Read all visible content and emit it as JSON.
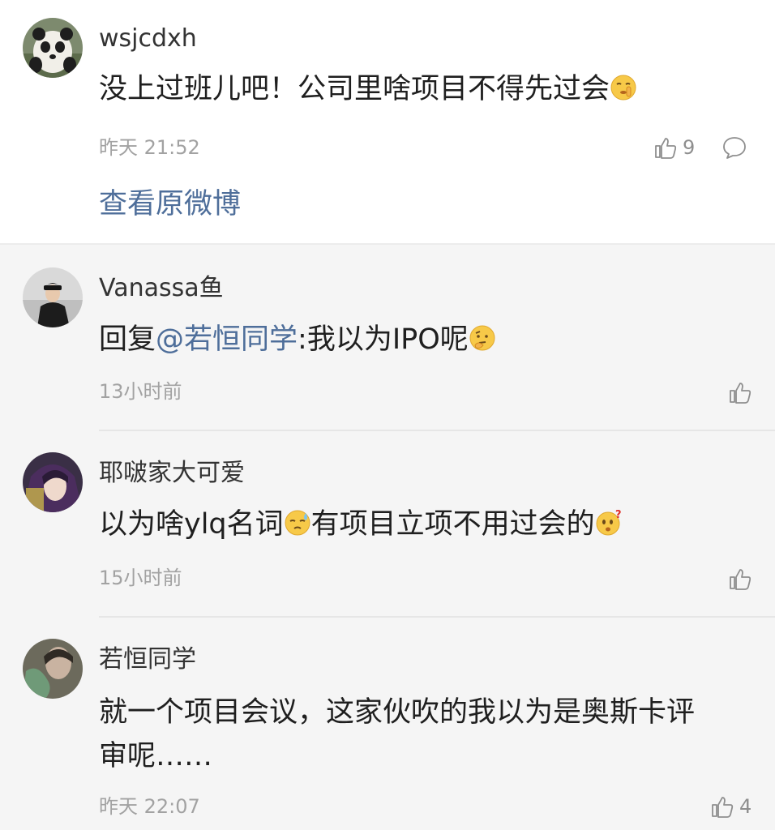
{
  "main_comment": {
    "username": "wsjcdxh",
    "content_text": "没上过班儿吧！公司里啥项目不得先过会",
    "emoji": "shush-emoji",
    "time": "昨天 21:52",
    "like_count": "9",
    "view_original_label": "查看原微博"
  },
  "replies": [
    {
      "username": "Vanassa鱼",
      "reply_prefix": "回复",
      "mention": "@若恒同学",
      "content_text": ":我以为IPO呢",
      "emoji": "thinking-emoji",
      "time": "13小时前"
    },
    {
      "username": "耶啵家大可爱",
      "content_part1": "以为啥ylq名词",
      "emoji1": "sweat-emoji",
      "content_part2": "有项目立项不用过会的",
      "emoji2": "confused-emoji",
      "time": "15小时前"
    },
    {
      "username": "若恒同学",
      "content_line1": "就一个项目会议，这家伙吹的我以为是奥斯卡评",
      "content_line2": "审呢……",
      "time": "昨天 22:07",
      "like_count": "4"
    }
  ],
  "colors": {
    "link_blue": "#4e6e9a",
    "reply_background": "#f5f5f5",
    "meta_gray": "#a2a2a2"
  }
}
